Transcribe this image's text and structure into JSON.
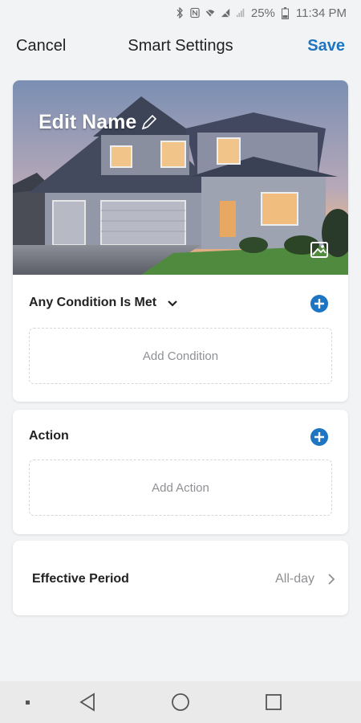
{
  "status_bar": {
    "icons": [
      "bluetooth-icon",
      "nfc-icon",
      "wifi-icon",
      "no-signal-icon",
      "signal-icon",
      "battery-icon"
    ],
    "battery": "25%",
    "time": "11:34 PM"
  },
  "header": {
    "cancel": "Cancel",
    "title": "Smart Settings",
    "save": "Save"
  },
  "hero": {
    "edit_name": "Edit Name",
    "icons": [
      "pencil-icon",
      "image-icon"
    ]
  },
  "condition": {
    "title": "Any Condition Is Met",
    "add_label": "Add Condition",
    "icons": [
      "chevron-down-icon",
      "plus-circle-icon"
    ]
  },
  "action": {
    "title": "Action",
    "add_label": "Add Action",
    "icons": [
      "plus-circle-icon"
    ]
  },
  "effective_period": {
    "label": "Effective Period",
    "value": "All-day",
    "icon": "chevron-right-icon"
  },
  "nav": {
    "icons": [
      "recent-dot-icon",
      "back-icon",
      "home-icon",
      "overview-icon"
    ]
  },
  "colors": {
    "accent": "#1e75c2",
    "background": "#f2f3f5"
  }
}
